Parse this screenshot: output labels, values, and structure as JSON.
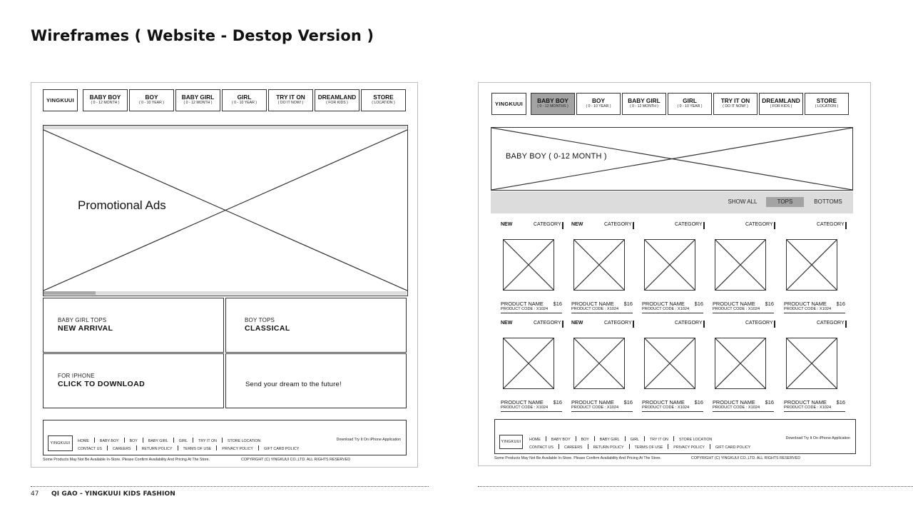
{
  "page": {
    "title": "Wireframes ( Website - Destop Version )",
    "page_number": "47",
    "footer_text": "QI GAO - YINGKUUI KIDS FASHION"
  },
  "brand": "YINGKUUI",
  "footer_brand": "YINGKUUI",
  "nav": [
    {
      "name": "BABY BOY",
      "sub": "( 0 - 12 MONTH )"
    },
    {
      "name": "BOY",
      "sub": "( 0 - 10 YEAR )"
    },
    {
      "name": "BABY GIRL",
      "sub": "( 0 - 12 MONTH )"
    },
    {
      "name": "GIRL",
      "sub": "( 0 - 10 YEAR )"
    },
    {
      "name": "TRY IT ON",
      "sub": "( DO IT NOW! )"
    },
    {
      "name": "DREAMLAND",
      "sub": "( FOR KIDS )"
    },
    {
      "name": "STORE",
      "sub": "( LOCATION )"
    }
  ],
  "nav_right": [
    {
      "name": "BABY BOY",
      "sub": "( 0 - 12 MONTHS )"
    },
    {
      "name": "BOY",
      "sub": "( 0 - 10 YEAR )"
    },
    {
      "name": "BABY GIRL",
      "sub": "( 0 - 12 MONTH )"
    },
    {
      "name": "GIRL",
      "sub": "( 0 - 10 YEAR )"
    },
    {
      "name": "TRY IT ON",
      "sub": "( DO IT NOW! )"
    },
    {
      "name": "DREAMLAND",
      "sub": "( FOR KIDS )"
    },
    {
      "name": "STORE",
      "sub": "( LOCATION )"
    }
  ],
  "home": {
    "promo": "Promotional Ads",
    "tiles": {
      "baby_girl_small": "BABY GIRL TOPS",
      "baby_girl_big": "NEW ARRIVAL",
      "boy_small": "BOY TOPS",
      "boy_big": "CLASSICAL",
      "iphone_small": "FOR IPHONE",
      "iphone_big": "CLICK TO DOWNLOAD",
      "dream": "Send your dream to the future!"
    }
  },
  "footer": {
    "links_row1": [
      "HOME",
      "BABY BOY",
      "BOY",
      "BABY GIRL",
      "GIRL",
      "TRY IT ON",
      "STORE LOCATION"
    ],
    "links_row2": [
      "CONTACT US",
      "CAREERS",
      "RETURN POLICY",
      "TERMS OF USE",
      "PRIVACY POLICY",
      "GIFT CARD POLICY"
    ],
    "download": "Download Try It On iPhone Application",
    "disclaimer": "Some Products May Not Be Available In-Store. Please Confirm Availability And Pricing At The Store.",
    "copyright": "COPYRIGHT (C) YINGKUUI CO.,LTD. ALL RIGHTS RESERVED"
  },
  "category_page": {
    "banner": "BABY BOY ( 0-12 MONTH )",
    "filters": [
      "SHOW ALL",
      "TOPS",
      "BOTTOMS"
    ],
    "active_filter": "TOPS",
    "new_label": "NEW",
    "category_label": "CATEGORY",
    "rows": [
      {
        "new_flags": [
          true,
          true,
          false,
          false,
          false
        ]
      },
      {
        "new_flags": [
          true,
          true,
          false,
          false,
          false
        ]
      }
    ],
    "product": {
      "name": "PRODUCT NAME",
      "price": "$16",
      "code": "PRODUCT CODE : X1024"
    }
  }
}
